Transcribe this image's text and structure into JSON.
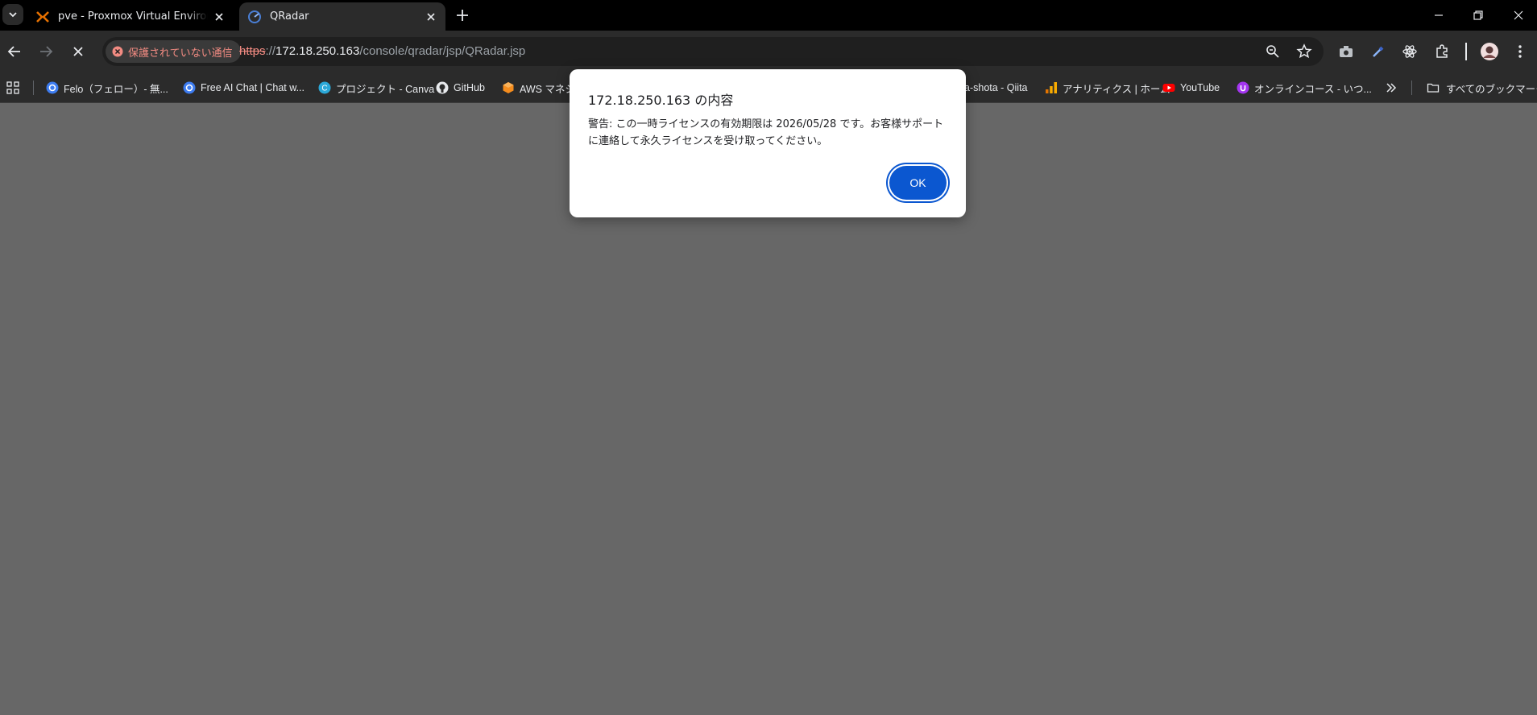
{
  "tabs": [
    {
      "title": "pve - Proxmox Virtual Environment",
      "active": false,
      "icon": "proxmox-icon"
    },
    {
      "title": "QRadar",
      "active": true,
      "icon": "qradar-icon"
    }
  ],
  "toolbar": {
    "security_label": "保護されていない通信",
    "url_scheme": "https",
    "url_sep": "://",
    "url_host": "172.18.250.163",
    "url_path": "/console/qradar/jsp/QRadar.jsp"
  },
  "bookmarks": [
    {
      "label": "Felo（フェロー）- 無...",
      "icon": "felo-icon"
    },
    {
      "label": "Free AI Chat | Chat w...",
      "icon": "felo-icon"
    },
    {
      "label": "プロジェクト - Canva",
      "icon": "canva-icon"
    },
    {
      "label": "GitHub",
      "icon": "github-icon"
    },
    {
      "label": "AWS マネジ",
      "icon": "aws-icon"
    },
    {
      "label": "a-shota - Qiita",
      "icon": ""
    },
    {
      "label": "アナリティクス | ホーム",
      "icon": "analytics-icon"
    },
    {
      "label": "YouTube",
      "icon": "youtube-icon"
    },
    {
      "label": "オンラインコース - いつ...",
      "icon": "udemy-icon"
    }
  ],
  "all_bookmarks_label": "すべてのブックマーク",
  "dialog": {
    "title": "172.18.250.163 の内容",
    "message": "警告: この一時ライセンスの有効期限は 2026/05/28 です。お客様サポートに連絡して永久ライセンスを受け取ってください。",
    "ok_label": "OK"
  },
  "colors": {
    "page_background": "#676767",
    "chrome_dark": "#2b2b2b",
    "ok_button": "#0b57d0",
    "insecure_red": "#f28b82"
  }
}
